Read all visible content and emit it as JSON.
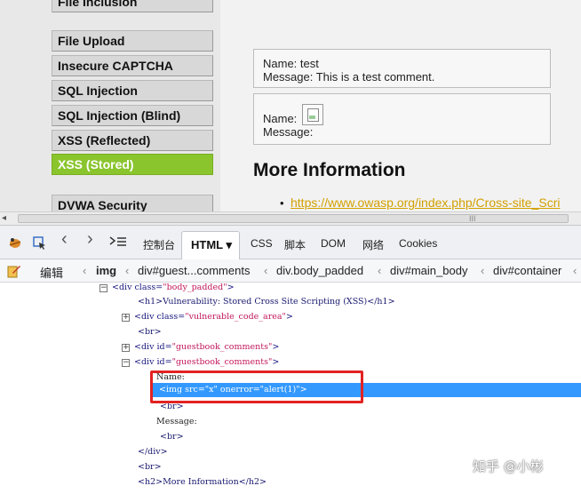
{
  "menu": {
    "items": [
      {
        "label": "File Inclusion",
        "selected": false
      },
      {
        "label": "File Upload",
        "selected": false
      },
      {
        "label": "Insecure CAPTCHA",
        "selected": false
      },
      {
        "label": "SQL Injection",
        "selected": false
      },
      {
        "label": "SQL Injection (Blind)",
        "selected": false
      },
      {
        "label": "XSS (Reflected)",
        "selected": false
      },
      {
        "label": "XSS (Stored)",
        "selected": true
      },
      {
        "label": "DVWA Security",
        "selected": false
      }
    ]
  },
  "comments": [
    {
      "name_line": "Name: test",
      "message_line": "Message: This is a test comment."
    },
    {
      "name_line": "Name:",
      "message_line": "Message:",
      "has_broken_image": true
    }
  ],
  "more_info": {
    "title": "More Information",
    "link": "https://www.owasp.org/index.php/Cross-site_Scri"
  },
  "top_corner_glyph": "’",
  "scrollbar": {
    "grip": "III",
    "left_arrow": "◂"
  },
  "devtools": {
    "tabs": {
      "console": "控制台",
      "html": "HTML ▾",
      "css": "CSS",
      "script": "脚本",
      "dom": "DOM",
      "net": "网络",
      "cookies": "Cookies"
    },
    "icons": {
      "firebug": "firebug-icon",
      "inspect": "inspect-icon",
      "back": "‹",
      "forward": "›",
      "command_line": "≤"
    },
    "edit_label": "编辑",
    "breadcrumb": [
      "img",
      "div#guest...comments",
      "div.body_padded",
      "div#main_body",
      "div#container"
    ]
  },
  "dom_tree": {
    "line0": {
      "open": "<div",
      "attr": "class=",
      "val": "\"body_padded\"",
      "close": ">"
    },
    "line1": "<h1>Vulnerability: Stored Cross Site Scripting (XSS)</h1>",
    "line2": {
      "open": "<div",
      "attr": "class=",
      "val": "\"vulnerable_code_area\"",
      "close": ">"
    },
    "line3": "<br>",
    "line4": {
      "open": "<div",
      "attr": "id=",
      "val": "\"guestbook_comments\"",
      "close": ">"
    },
    "line5": {
      "open": "<div",
      "attr": "id=",
      "val": "\"guestbook_comments\"",
      "close": ">"
    },
    "line6": "Name:",
    "line7": "<img  src=\"x\"  onerror=\"alert(1)\">",
    "line8": "<br>",
    "line9": "Message:",
    "line10": "<br>",
    "line11": "</div>",
    "line12": "<br>",
    "line13": "<h2>More Information</h2>"
  },
  "watermark": "知乎 @小彬"
}
